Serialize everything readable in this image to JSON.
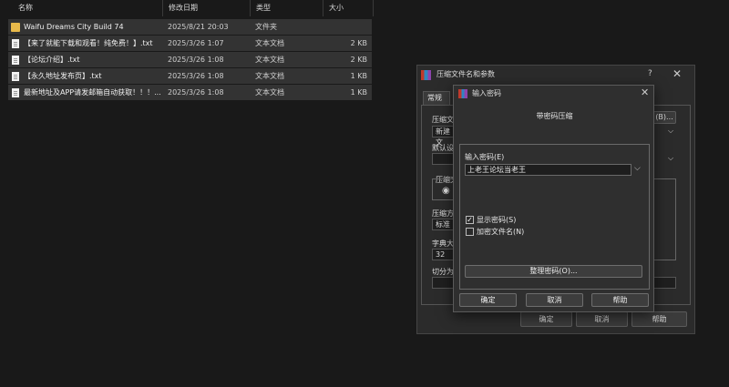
{
  "explorer": {
    "headers": {
      "name": "名称",
      "date": "修改日期",
      "type": "类型",
      "size": "大小"
    },
    "rows": [
      {
        "icon": "folder-icon",
        "name": "Waifu Dreams City Build 74",
        "date": "2025/8/21 20:03",
        "type": "文件夹",
        "size": ""
      },
      {
        "icon": "text-file-icon",
        "name": "【来了就能下载和观看！纯免费！】.txt",
        "date": "2025/3/26 1:07",
        "type": "文本文档",
        "size": "2 KB"
      },
      {
        "icon": "text-file-icon",
        "name": "【论坛介绍】.txt",
        "date": "2025/3/26 1:08",
        "type": "文本文档",
        "size": "2 KB"
      },
      {
        "icon": "text-file-icon",
        "name": "【永久地址发布页】.txt",
        "date": "2025/3/26 1:08",
        "type": "文本文档",
        "size": "1 KB"
      },
      {
        "icon": "text-file-icon",
        "name": "最新地址及APP请发邮箱自动获取！！！...",
        "date": "2025/3/26 1:08",
        "type": "文本文档",
        "size": "1 KB"
      }
    ]
  },
  "archive_dialog": {
    "title": "压缩文件名和参数",
    "help": "?",
    "close": "✕",
    "tab_general": "常规",
    "frag_archive_name": "压缩文",
    "frag_browse": "(B)...",
    "frag_new": "新建文",
    "frag_default": "默认设",
    "frag_format": "压缩文",
    "frag_method": "压缩方",
    "frag_method_value": "标准",
    "frag_dict": "字典大",
    "frag_dict_value": "32",
    "frag_split": "切分为",
    "ok": "确定",
    "cancel": "取消",
    "help_btn": "帮助"
  },
  "password_dialog": {
    "title": "输入密码",
    "close": "✕",
    "heading": "带密码压缩",
    "password_label": "输入密码(E)",
    "password_value": "上老王论坛当老王",
    "show_password_label": "显示密码(S)",
    "show_password_checked": "✓",
    "encrypt_names_label": "加密文件名(N)",
    "organize_button": "整理密码(O)...",
    "ok": "确定",
    "cancel": "取消",
    "help": "帮助"
  },
  "colors": {
    "background": "#191919",
    "row": "#333333",
    "folder": "#e8b94a"
  }
}
